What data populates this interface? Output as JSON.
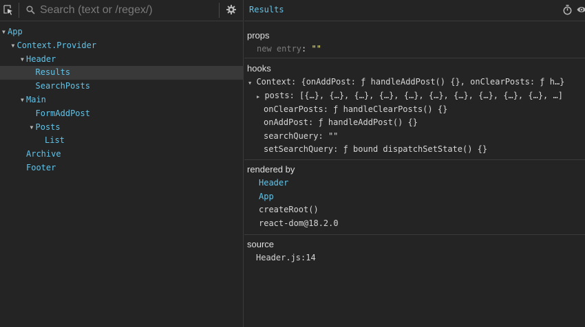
{
  "search": {
    "placeholder": "Search (text or /regex/)"
  },
  "tree": [
    {
      "label": "App",
      "depth": 0,
      "arrow": "▼",
      "selected": false
    },
    {
      "label": "Context.Provider",
      "depth": 1,
      "arrow": "▼",
      "selected": false
    },
    {
      "label": "Header",
      "depth": 2,
      "arrow": "▼",
      "selected": false
    },
    {
      "label": "Results",
      "depth": 3,
      "arrow": "",
      "selected": true
    },
    {
      "label": "SearchPosts",
      "depth": 3,
      "arrow": "",
      "selected": false
    },
    {
      "label": "Main",
      "depth": 2,
      "arrow": "▼",
      "selected": false
    },
    {
      "label": "FormAddPost",
      "depth": 3,
      "arrow": "",
      "selected": false
    },
    {
      "label": "Posts",
      "depth": 3,
      "arrow": "▼",
      "selected": false
    },
    {
      "label": "List",
      "depth": 4,
      "arrow": "",
      "selected": false
    },
    {
      "label": "Archive",
      "depth": 2,
      "arrow": "",
      "selected": false
    },
    {
      "label": "Footer",
      "depth": 2,
      "arrow": "",
      "selected": false
    }
  ],
  "details": {
    "component_name": "Results",
    "props": {
      "title": "props",
      "new_entry_key": "new entry",
      "new_entry_value": "\"\""
    },
    "hooks": {
      "title": "hooks",
      "context_key": "Context",
      "context_value": "{onAddPost: ƒ handleAddPost() {}, onClearPosts: ƒ h…}",
      "posts_key": "posts",
      "posts_value": "[{…}, {…}, {…}, {…}, {…}, {…}, {…}, {…}, {…}, {…}, …]",
      "onClearPosts_key": "onClearPosts",
      "onClearPosts_value": "ƒ handleClearPosts() {}",
      "onAddPost_key": "onAddPost",
      "onAddPost_value": "ƒ handleAddPost() {}",
      "searchQuery_key": "searchQuery",
      "searchQuery_value": "\"\"",
      "setSearchQuery_key": "setSearchQuery",
      "setSearchQuery_value": "ƒ bound dispatchSetState() {}"
    },
    "rendered_by": {
      "title": "rendered by",
      "items": [
        "Header",
        "App",
        "createRoot()",
        "react-dom@18.2.0"
      ]
    },
    "source": {
      "title": "source",
      "file": "Header.js:14"
    }
  }
}
